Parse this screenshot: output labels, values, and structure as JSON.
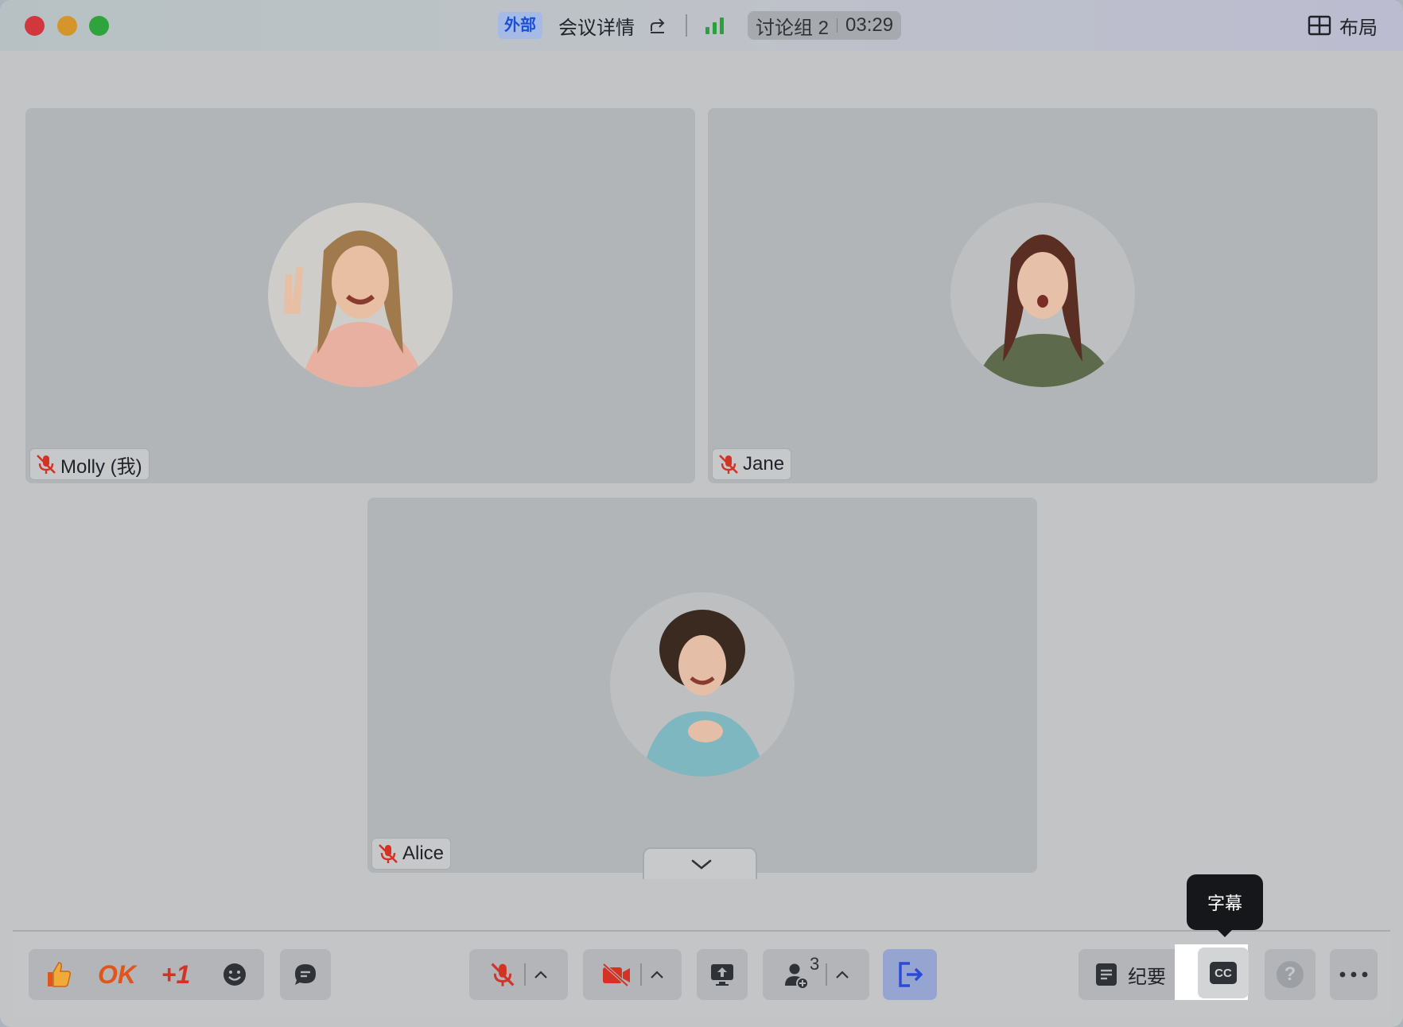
{
  "titlebar": {
    "badge": "外部",
    "meeting_detail": "会议详情",
    "group_name": "讨论组 2",
    "timer": "03:29",
    "layout_label": "布局"
  },
  "participants": [
    {
      "name": "Molly (我)",
      "muted": true,
      "avatar_icon": "woman-waving-photo"
    },
    {
      "name": "Jane",
      "muted": true,
      "avatar_icon": "woman-surprised-photo"
    },
    {
      "name": "Alice",
      "muted": true,
      "avatar_icon": "woman-laughing-photo"
    }
  ],
  "toolbar": {
    "reactions": {
      "ok": "OK",
      "plus_one": "+1"
    },
    "participants_count": "3",
    "minutes_label": "纪要",
    "cc_label": "CC",
    "help_label": "?"
  },
  "tooltip": {
    "text": "字幕"
  },
  "colors": {
    "accent_blue": "#1a4fd6",
    "mute_red": "#d33325",
    "signal_green": "#2aa13d",
    "leave_blue": "#2a4bd6"
  }
}
